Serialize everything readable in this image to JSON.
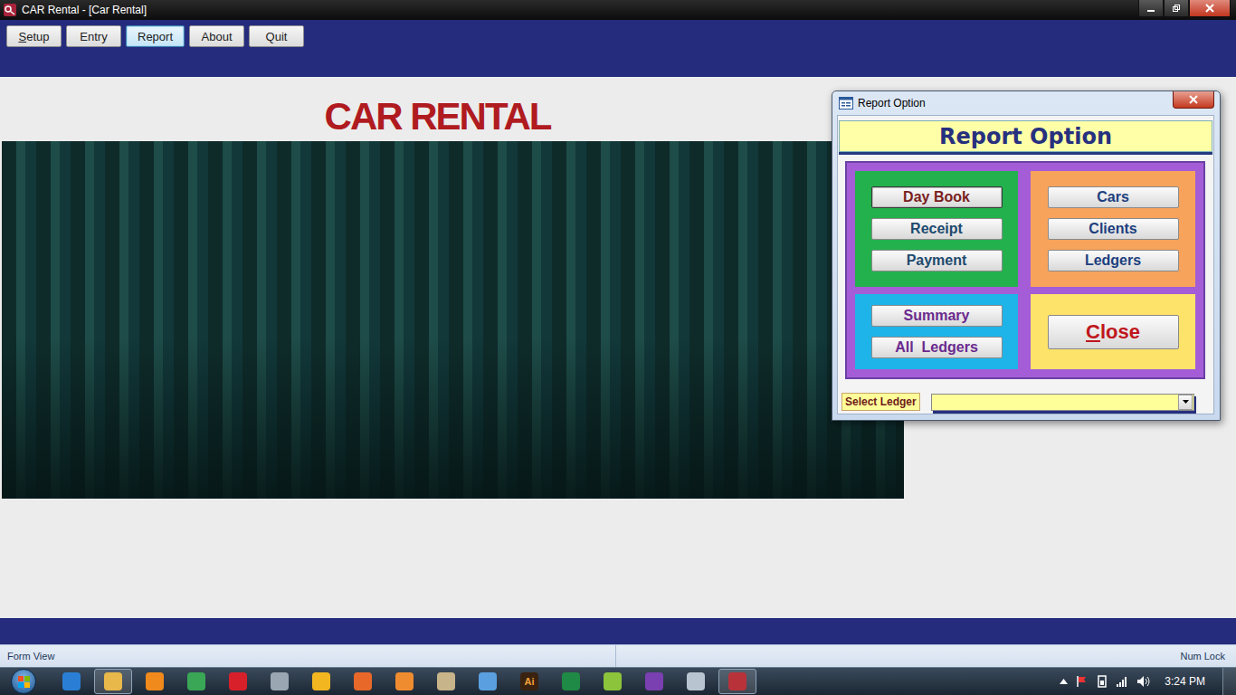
{
  "window": {
    "title": "CAR Rental - [Car Rental]"
  },
  "menu": [
    {
      "label": "Setup",
      "selected": false,
      "underlineFirst": true
    },
    {
      "label": "Entry",
      "selected": false,
      "underlineFirst": false
    },
    {
      "label": "Report",
      "selected": true,
      "underlineFirst": false
    },
    {
      "label": "About",
      "selected": false,
      "underlineFirst": false
    },
    {
      "label": "Quit",
      "selected": false,
      "underlineFirst": false
    }
  ],
  "heading": "CAR RENTAL",
  "dialog": {
    "title": "Report Option",
    "header": "Report Option",
    "groups": [
      {
        "color": "#22b14c",
        "buttons": [
          {
            "label": "Day Book",
            "kind": "small",
            "focused": true,
            "underlineFirst": false,
            "textColor": "#7a1e1e"
          },
          {
            "label": "Receipt",
            "kind": "small",
            "focused": false,
            "underlineFirst": false,
            "textColor": "#1d4a6e"
          },
          {
            "label": "Payment",
            "kind": "small",
            "focused": false,
            "underlineFirst": false,
            "textColor": "#1d4a6e"
          }
        ]
      },
      {
        "color": "#f7a35c",
        "buttons": [
          {
            "label": "Cars",
            "kind": "small",
            "focused": false,
            "underlineFirst": false,
            "textColor": "#1d3f7e"
          },
          {
            "label": "Clients",
            "kind": "small",
            "focused": false,
            "underlineFirst": false,
            "textColor": "#1d3f7e"
          },
          {
            "label": "Ledgers",
            "kind": "small",
            "focused": false,
            "underlineFirst": false,
            "textColor": "#1d3f7e"
          }
        ]
      },
      {
        "color": "#1eb4ea",
        "buttons": [
          {
            "label": "Summary",
            "kind": "small",
            "focused": false,
            "underlineFirst": false,
            "textColor": "#6a2a8e"
          },
          {
            "label": "All  Ledgers",
            "kind": "small",
            "focused": false,
            "underlineFirst": false,
            "textColor": "#6a2a8e"
          }
        ]
      },
      {
        "color": "#fde36a",
        "buttons": [
          {
            "label": "Close",
            "kind": "large",
            "focused": false,
            "underlineFirst": true,
            "textColor": "#c0161c"
          }
        ]
      }
    ],
    "select": {
      "label": "Select Ledger",
      "value": ""
    }
  },
  "status_bar": {
    "left": "Form View",
    "right": "Num Lock"
  },
  "taskbar": {
    "time": "3:24 PM",
    "apps": [
      {
        "color": "#2a7fd4",
        "selected": false,
        "glyph": ""
      },
      {
        "color": "#e8b84a",
        "selected": true,
        "glyph": ""
      },
      {
        "color": "#f08a1c",
        "selected": false,
        "glyph": ""
      },
      {
        "color": "#3aa757",
        "selected": false,
        "glyph": ""
      },
      {
        "color": "#d8202a",
        "selected": false,
        "glyph": ""
      },
      {
        "color": "#9aa6b2",
        "selected": false,
        "glyph": ""
      },
      {
        "color": "#f2b620",
        "selected": false,
        "glyph": ""
      },
      {
        "color": "#e8682a",
        "selected": false,
        "glyph": ""
      },
      {
        "color": "#f08c30",
        "selected": false,
        "glyph": ""
      },
      {
        "color": "#c8b48a",
        "selected": false,
        "glyph": ""
      },
      {
        "color": "#5aa0e0",
        "selected": false,
        "glyph": ""
      },
      {
        "color": "#3a2210",
        "selected": false,
        "glyph": "Ai"
      },
      {
        "color": "#1f8a45",
        "selected": false,
        "glyph": ""
      },
      {
        "color": "#8cc43c",
        "selected": false,
        "glyph": ""
      },
      {
        "color": "#7a3fb0",
        "selected": false,
        "glyph": ""
      },
      {
        "color": "#b8c4d0",
        "selected": false,
        "glyph": ""
      },
      {
        "color": "#b8323a",
        "selected": true,
        "glyph": ""
      }
    ]
  }
}
